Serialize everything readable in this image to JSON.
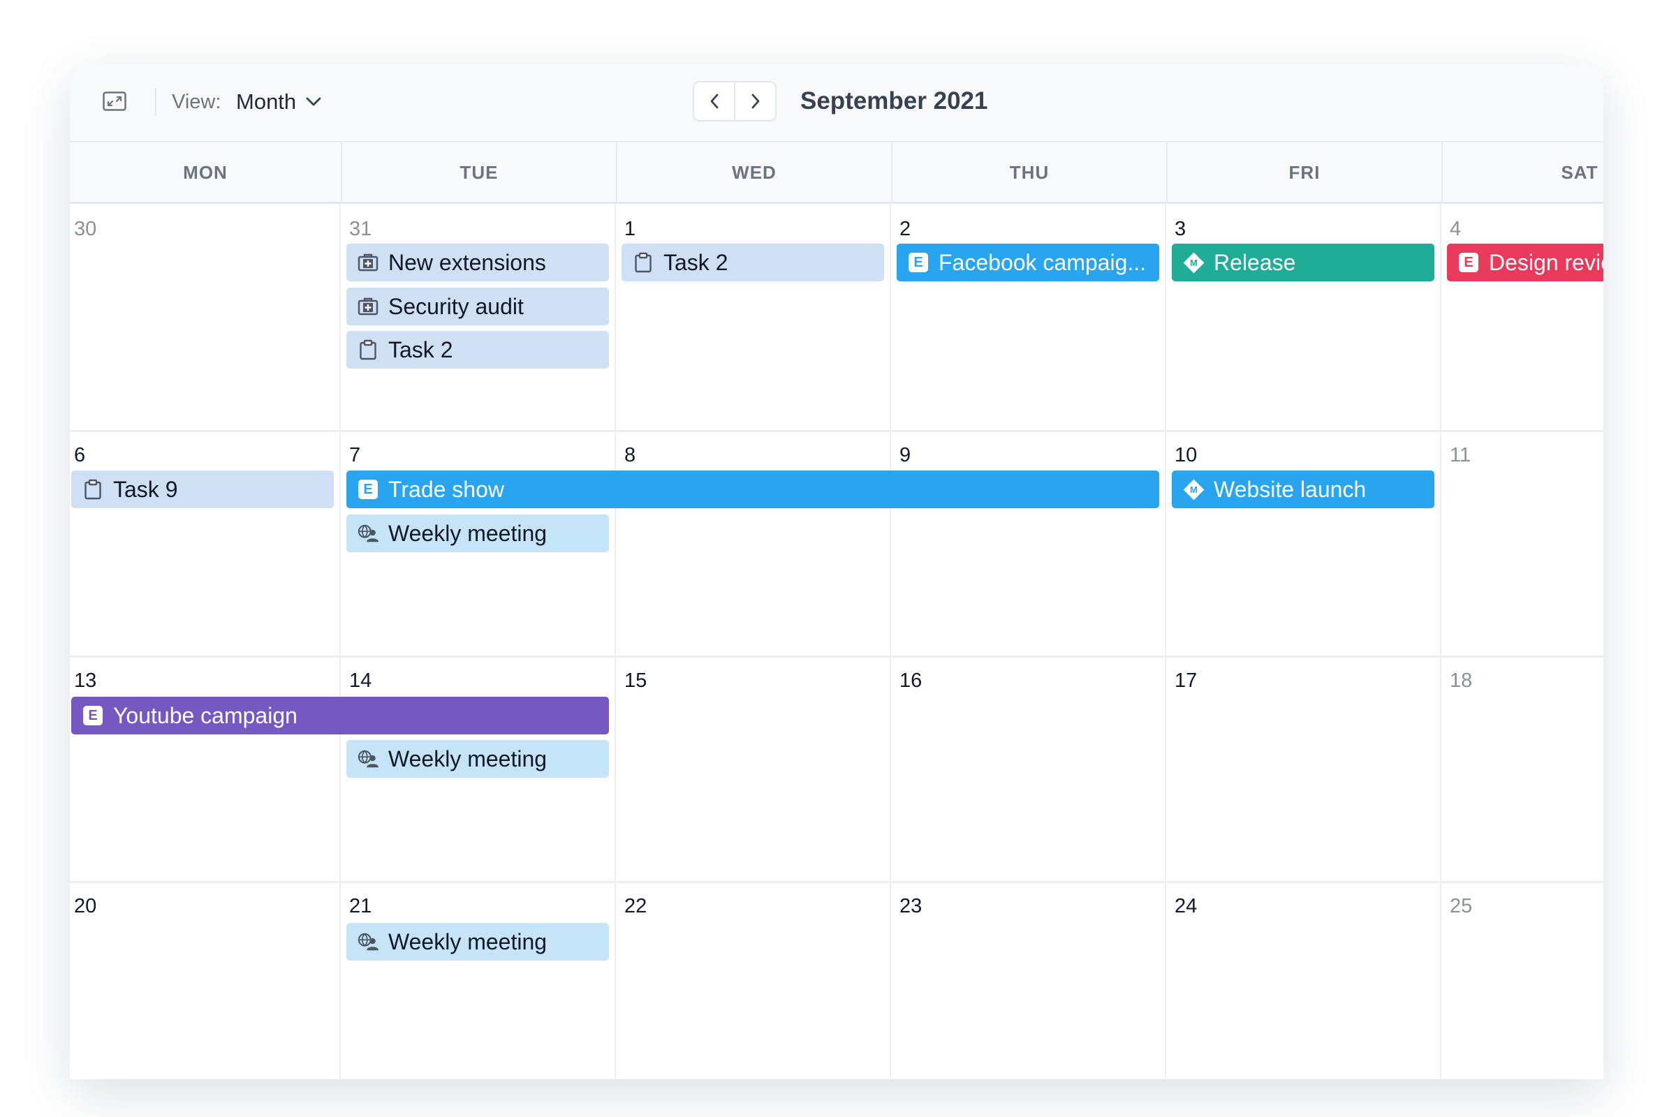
{
  "toolbar": {
    "view_label": "View:",
    "view_value": "Month",
    "prev_icon": "chevron-left-icon",
    "next_icon": "chevron-right-icon",
    "expand_icon": "expand-icon",
    "period_title": "September 2021"
  },
  "colors": {
    "task": "#cfe0f5",
    "meeting": "#c5e4f7",
    "event_blue": "#28a5ee",
    "milestone_teal": "#20ad98",
    "event_red": "#ea3a5c",
    "event_purple": "#7558c2"
  },
  "days": [
    "MON",
    "TUE",
    "WED",
    "THU",
    "FRI",
    "SAT"
  ],
  "weeks": [
    {
      "dates": [
        "30",
        "31",
        "1",
        "2",
        "3",
        "4"
      ]
    },
    {
      "dates": [
        "6",
        "7",
        "8",
        "9",
        "10",
        "11"
      ]
    },
    {
      "dates": [
        "13",
        "14",
        "15",
        "16",
        "17",
        "18"
      ]
    },
    {
      "dates": [
        "20",
        "21",
        "22",
        "23",
        "24",
        "25"
      ]
    }
  ],
  "events": {
    "new_extensions": {
      "label": "New extensions",
      "icon": "briefcase-icon"
    },
    "security_audit": {
      "label": "Security audit",
      "icon": "briefcase-icon"
    },
    "task_2_tue": {
      "label": "Task 2",
      "icon": "clipboard-icon"
    },
    "task_2_wed": {
      "label": "Task 2",
      "icon": "clipboard-icon"
    },
    "facebook_campaign": {
      "label": "Facebook campaig...",
      "badge": "E"
    },
    "release": {
      "label": "Release",
      "badge": "M"
    },
    "design_review": {
      "label": "Design revie",
      "badge": "E"
    },
    "task_9": {
      "label": "Task 9",
      "icon": "clipboard-icon"
    },
    "trade_show": {
      "label": "Trade show",
      "badge": "E"
    },
    "website_launch": {
      "label": "Website launch",
      "badge": "M"
    },
    "weekly_meeting_1": {
      "label": "Weekly meeting",
      "icon": "meeting-icon"
    },
    "youtube_campaign": {
      "label": "Youtube campaign",
      "badge": "E"
    },
    "weekly_meeting_2": {
      "label": "Weekly meeting",
      "icon": "meeting-icon"
    },
    "weekly_meeting_3": {
      "label": "Weekly meeting",
      "icon": "meeting-icon"
    }
  }
}
